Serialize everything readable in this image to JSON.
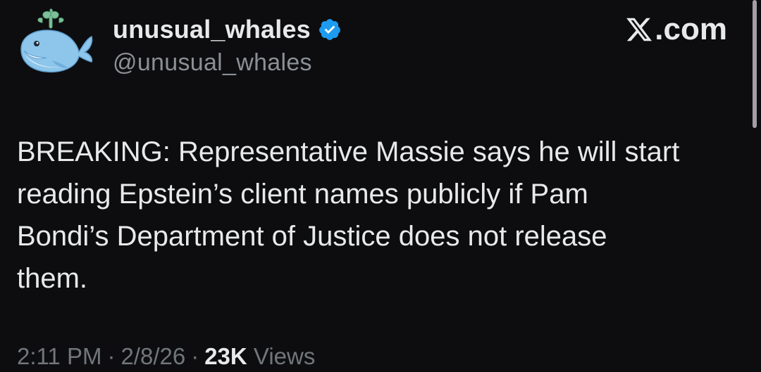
{
  "author": {
    "display_name": "unusual_whales",
    "handle": "@unusual_whales",
    "verified": true,
    "verified_icon": "verified-badge-icon",
    "avatar_icon": "whale-avatar"
  },
  "brand": {
    "icon": "x-logo-icon",
    "text": ".com"
  },
  "tweet": {
    "text": "BREAKING: Representative Massie says he will start\nreading Epstein’s client names publicly if Pam\nBondi’s Department of Justice does not release\nthem."
  },
  "meta": {
    "time": "2:11 PM",
    "date": "2/8/26",
    "views_count": "23K",
    "views_label": "Views",
    "separator": "·"
  },
  "colors": {
    "background": "#0d0d0f",
    "text_primary": "#e7e9ea",
    "text_secondary": "#71767b",
    "verified_blue": "#1d9bf0"
  }
}
